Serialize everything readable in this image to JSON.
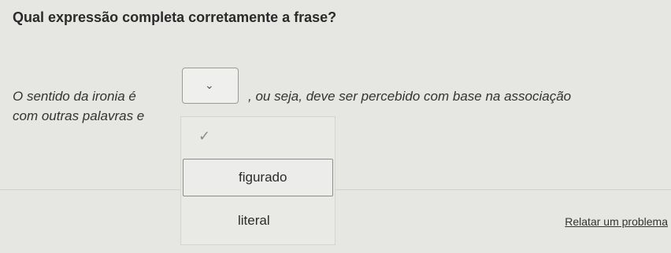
{
  "question": {
    "title": "Qual expressão completa corretamente a frase?"
  },
  "sentence": {
    "before_blank": "O sentido da ironia é",
    "after_blank": ", ou seja, deve ser percebido com base na associação",
    "line2": "com outras palavras e"
  },
  "dropdown": {
    "icon": "chevron-down-icon",
    "glyph": "⌄"
  },
  "menu": {
    "check_glyph": "✓",
    "options": [
      {
        "label": "figurado",
        "state": "focused"
      },
      {
        "label": "literal",
        "state": "default"
      }
    ]
  },
  "footer": {
    "report_link": "Relatar um problema"
  },
  "colors": {
    "background": "#e6e6e3",
    "text": "#2b2b2b",
    "border": "#9a9a9a"
  }
}
